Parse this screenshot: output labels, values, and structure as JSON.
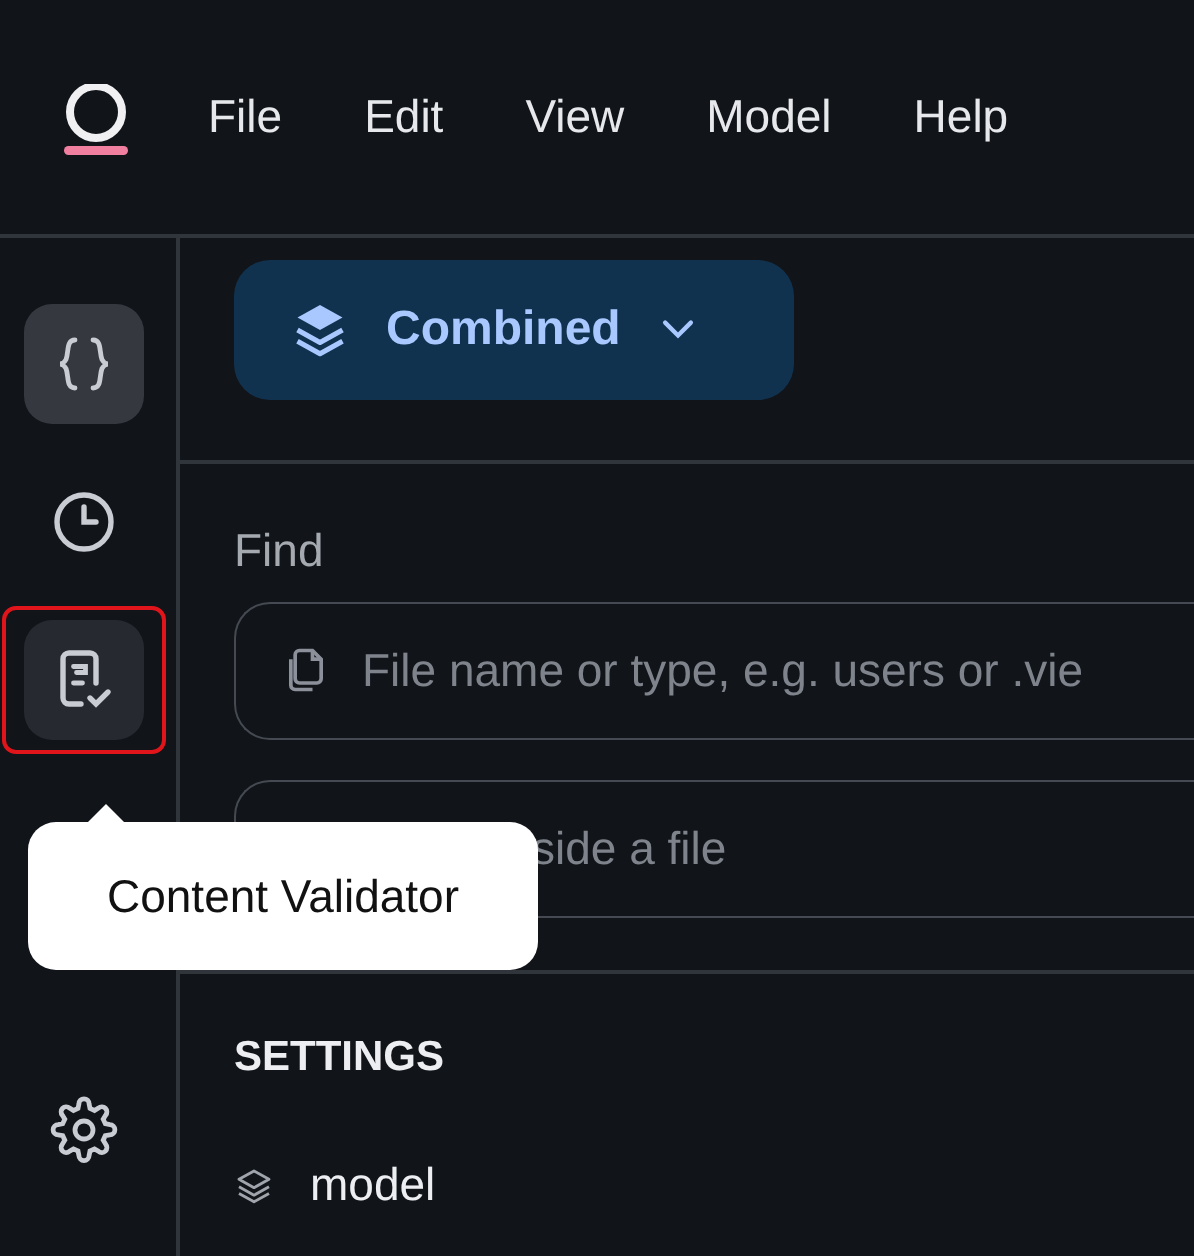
{
  "menu": [
    "File",
    "Edit",
    "View",
    "Model",
    "Help"
  ],
  "sidebar": {
    "items": [
      {
        "kind": "code",
        "selected": true,
        "outlined": false
      },
      {
        "kind": "history",
        "selected": false,
        "outlined": false
      },
      {
        "kind": "validator",
        "selected": false,
        "outlined": true
      }
    ],
    "bottom": {
      "kind": "settings",
      "selected": false
    }
  },
  "tooltip": "Content Validator",
  "view_selector": {
    "label": "Combined"
  },
  "find": {
    "label": "Find",
    "fields": [
      {
        "kind": "file",
        "placeholder": "File name or type, e.g. users or .vie"
      },
      {
        "kind": "text",
        "placeholder": "side a file"
      }
    ]
  },
  "settings": {
    "heading": "SETTINGS",
    "items": [
      {
        "label": "model"
      }
    ]
  }
}
